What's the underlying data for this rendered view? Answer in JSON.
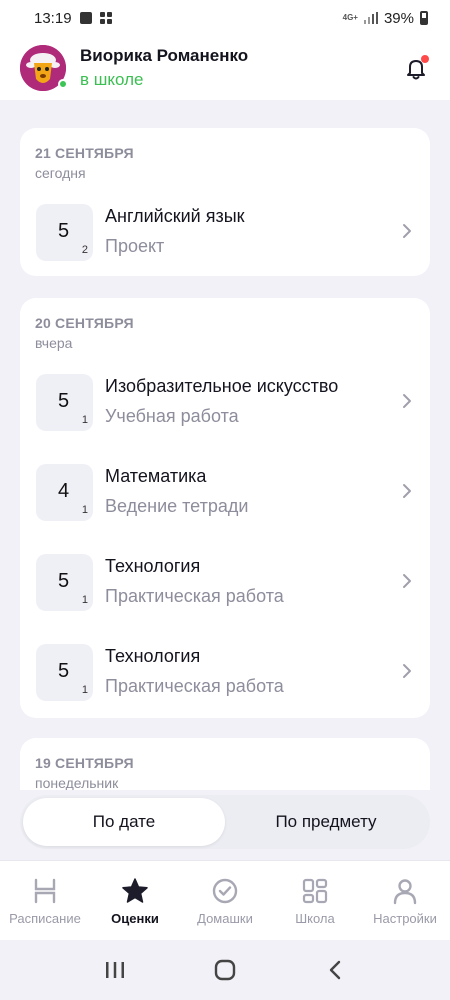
{
  "status_bar": {
    "time": "13:19",
    "network": "4G+",
    "battery": "39%"
  },
  "header": {
    "user_name": "Виорика Романенко",
    "user_status": "в школе"
  },
  "days": [
    {
      "date": "21 СЕНТЯБРЯ",
      "relative": "сегодня",
      "grades": [
        {
          "value": "5",
          "weight": "2",
          "subject": "Английский язык",
          "work_type": "Проект"
        }
      ]
    },
    {
      "date": "20 СЕНТЯБРЯ",
      "relative": "вчера",
      "grades": [
        {
          "value": "5",
          "weight": "1",
          "subject": "Изобразительное искусство",
          "work_type": "Учебная работа"
        },
        {
          "value": "4",
          "weight": "1",
          "subject": "Математика",
          "work_type": "Ведение тетради"
        },
        {
          "value": "5",
          "weight": "1",
          "subject": "Технология",
          "work_type": "Практическая работа"
        },
        {
          "value": "5",
          "weight": "1",
          "subject": "Технология",
          "work_type": "Практическая работа"
        }
      ]
    },
    {
      "date": "19 СЕНТЯБРЯ",
      "relative": "понедельник",
      "grades": []
    }
  ],
  "segmented": {
    "by_date": "По дате",
    "by_subject": "По предмету"
  },
  "bottom_nav": [
    {
      "label": "Расписание",
      "icon": "schedule-icon"
    },
    {
      "label": "Оценки",
      "icon": "star-icon"
    },
    {
      "label": "Домашки",
      "icon": "check-circle-icon"
    },
    {
      "label": "Школа",
      "icon": "grid-icon"
    },
    {
      "label": "Настройки",
      "icon": "person-icon"
    }
  ],
  "colors": {
    "online": "#3cbf52",
    "notification_dot": "#ff4a4a",
    "avatar_bg": "#b02a7a"
  }
}
